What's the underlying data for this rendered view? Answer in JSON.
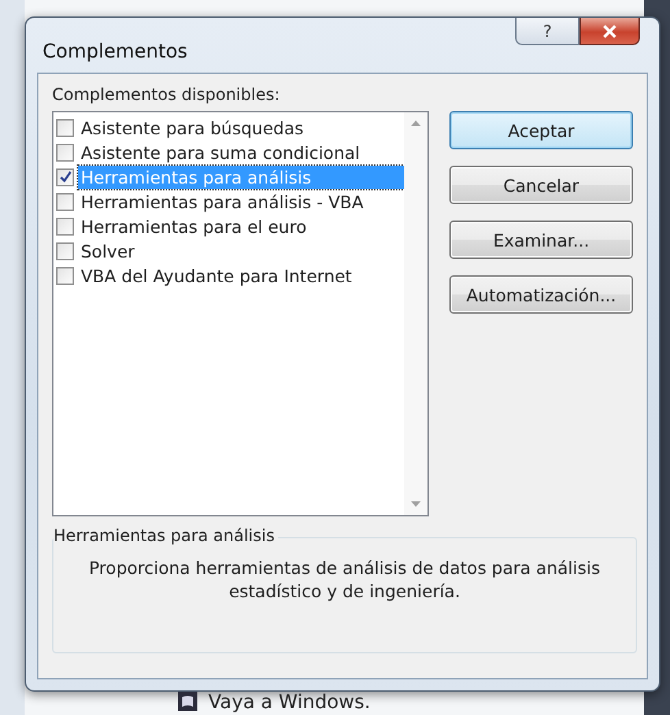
{
  "window": {
    "title": "Complementos",
    "help_button": {
      "label": "?"
    }
  },
  "addins": {
    "label": "Complementos disponibles:",
    "items": [
      {
        "name": "Asistente para búsquedas",
        "checked": false,
        "selected": false
      },
      {
        "name": "Asistente para suma condicional",
        "checked": false,
        "selected": false
      },
      {
        "name": "Herramientas para análisis",
        "checked": true,
        "selected": true
      },
      {
        "name": "Herramientas para análisis - VBA",
        "checked": false,
        "selected": false
      },
      {
        "name": "Herramientas para el euro",
        "checked": false,
        "selected": false
      },
      {
        "name": "Solver",
        "checked": false,
        "selected": false
      },
      {
        "name": "VBA del Ayudante para Internet",
        "checked": false,
        "selected": false
      }
    ]
  },
  "buttons": [
    {
      "label": "Aceptar",
      "default": true
    },
    {
      "label": "Cancelar",
      "default": false
    },
    {
      "label": "Examinar...",
      "default": false
    },
    {
      "label": "Automatización...",
      "default": false
    }
  ],
  "description": {
    "title": "Herramientas para análisis",
    "text": "Proporciona herramientas de análisis de datos para análisis estadístico y de ingeniería."
  },
  "background_app": {
    "text": "Vaya a Windows."
  }
}
